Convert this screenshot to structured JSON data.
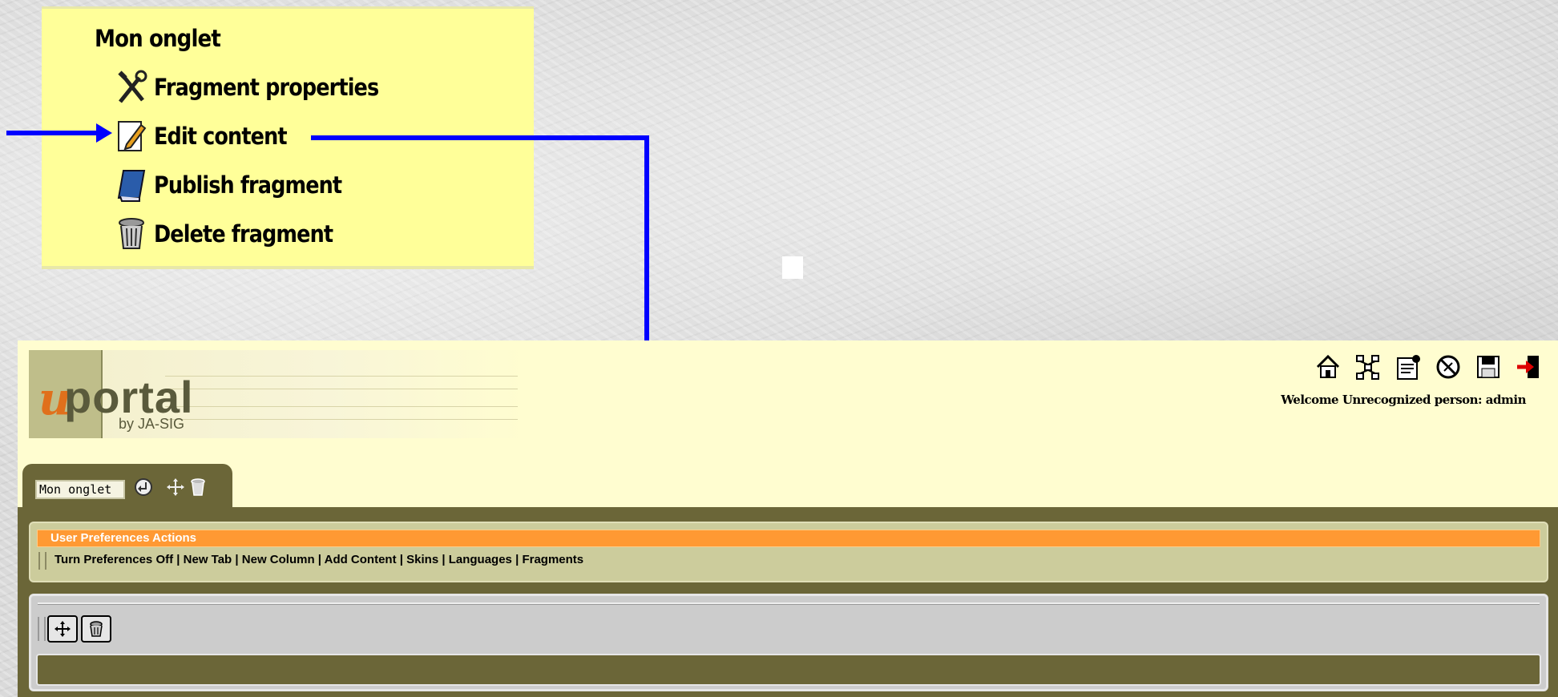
{
  "menu": {
    "title": "Mon onglet",
    "items": [
      {
        "label": "Fragment properties",
        "icon": "tools-icon"
      },
      {
        "label": "Edit content",
        "icon": "edit-content-icon"
      },
      {
        "label": "Publish fragment",
        "icon": "publish-book-icon"
      },
      {
        "label": "Delete fragment",
        "icon": "trash-icon"
      }
    ]
  },
  "portal": {
    "logo": {
      "u": "u",
      "name": "portal",
      "by": "by JA-SIG"
    },
    "toolbar_icons": [
      "home-icon",
      "channel-tree-icon",
      "preferences-icon",
      "disable-icon",
      "save-icon",
      "logout-icon"
    ],
    "welcome": "Welcome Unrecognized person: admin",
    "tab": {
      "name_value": "Mon onglet"
    },
    "prefs": {
      "title": "User Preferences Actions",
      "links": [
        "Turn Preferences Off",
        "New Tab",
        "New Column",
        "Add Content",
        "Skins",
        "Languages",
        "Fragments"
      ],
      "separator": " | "
    }
  },
  "colors": {
    "arrow": "#0000ff",
    "menu_bg": "#ffff99",
    "portal_bg": "#fffdd0",
    "dark": "#6b6638",
    "orange": "#ff9933"
  }
}
